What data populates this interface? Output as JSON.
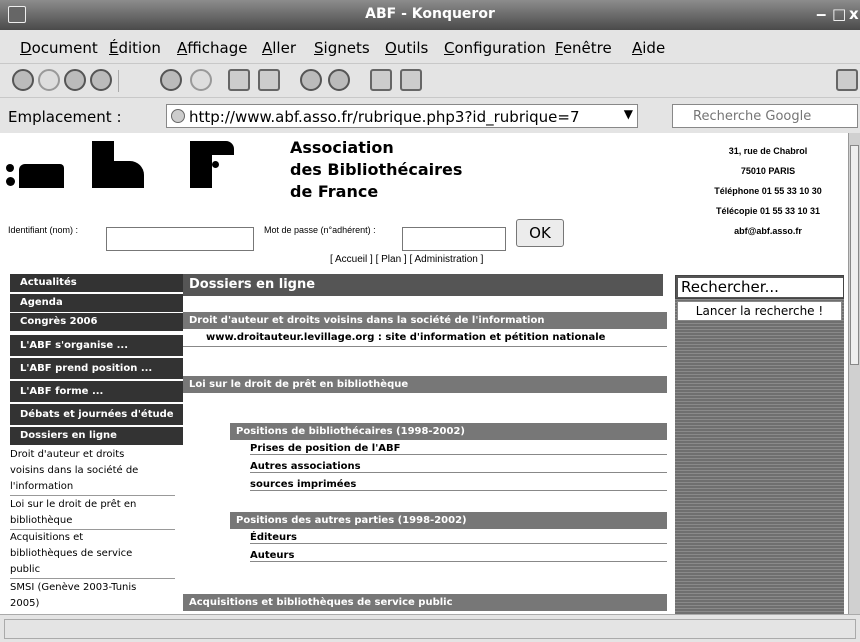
{
  "window": {
    "title": "ABF - Konqueror",
    "controls": [
      "‒",
      "□",
      "x"
    ]
  },
  "menu": [
    "Document",
    "Édition",
    "Affichage",
    "Aller",
    "Signets",
    "Outils",
    "Configuration",
    "Fenêtre",
    "Aide"
  ],
  "location": {
    "label": "Emplacement :",
    "url": "http://www.abf.asso.fr/rubrique.php3?id_rubrique=7",
    "search_placeholder": "Recherche Google"
  },
  "header": {
    "org": [
      "Association",
      "des Bibliothécaires",
      "de France"
    ],
    "contact": [
      "31, rue de Chabrol",
      "75010 PARIS",
      "Téléphone 01 55 33 10 30",
      "Télécopie 01 55 33 10 31",
      "abf@abf.asso.fr"
    ],
    "login_label": "Identifiant (nom) :",
    "password_label": "Mot de passe (n°adhérent) :",
    "ok": "OK",
    "links": "[ Accueil ] [ Plan ] [ Administration ]"
  },
  "nav": {
    "items": [
      "Actualités",
      "Agenda",
      "Congrès 2006",
      "L'ABF s'organise ...",
      "L'ABF prend position ...",
      "L'ABF forme ...",
      "Débats et journées d'étude",
      "Dossiers en ligne"
    ],
    "subitems": [
      [
        "Droit d'auteur et droits",
        "voisins dans la société de",
        "l'information"
      ],
      [
        "Loi sur le droit de prêt en",
        "bibliothèque"
      ],
      [
        "Acquisitions et",
        "bibliothèques de service",
        "public"
      ],
      [
        "SMSI (Genève 2003-Tunis",
        "2005)"
      ]
    ]
  },
  "main": {
    "title": "Dossiers en ligne",
    "s1": "Droit d'auteur et droits voisins dans la société de l'information",
    "s1_link": "www.droitauteur.levillage.org : site d'information et pétition nationale",
    "s2": "Loi sur le droit de prêt en bibliothèque",
    "sub1": "Positions de bibliothécaires (1998-2002)",
    "sub1_links": [
      "Prises de position de l'ABF",
      "Autres associations",
      "sources imprimées"
    ],
    "sub2": "Positions des autres parties (1998-2002)",
    "sub2_links": [
      "Éditeurs",
      "Auteurs"
    ],
    "s3": "Acquisitions et bibliothèques de service public"
  },
  "right": {
    "title": "Rechercher...",
    "button": "Lancer la recherche !"
  }
}
